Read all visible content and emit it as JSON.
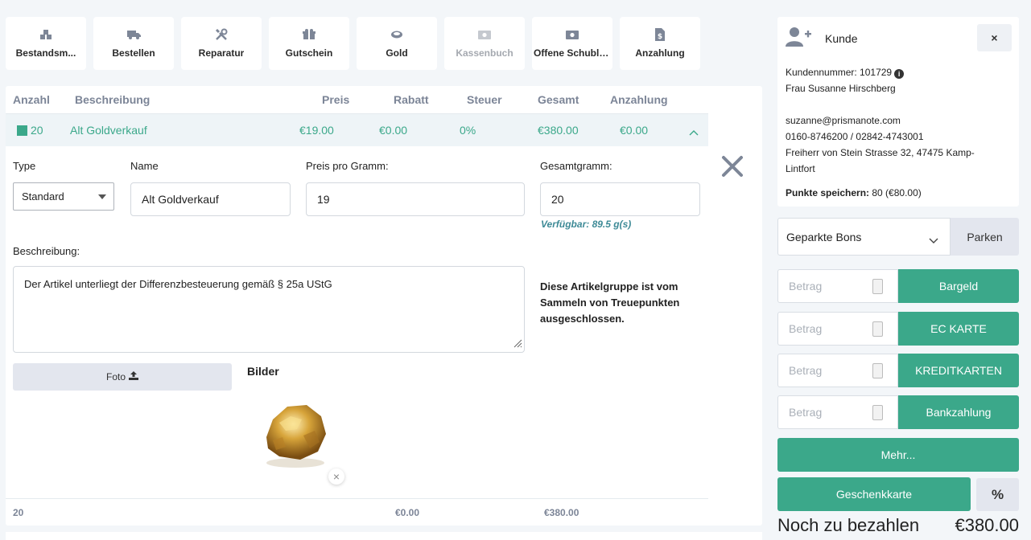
{
  "toolbar": [
    {
      "label": "Bestandsm...",
      "icon": "boxes-icon",
      "disabled": false
    },
    {
      "label": "Bestellen",
      "icon": "truck-icon",
      "disabled": false
    },
    {
      "label": "Reparatur",
      "icon": "tools-icon",
      "disabled": false
    },
    {
      "label": "Gutschein",
      "icon": "gift-icon",
      "disabled": false
    },
    {
      "label": "Gold",
      "icon": "gold-ring-icon",
      "disabled": false
    },
    {
      "label": "Kassenbuch",
      "icon": "money-bill-icon",
      "disabled": true
    },
    {
      "label": "Offene Schublade",
      "icon": "cash-drawer-icon",
      "disabled": false
    },
    {
      "label": "Anzahlung",
      "icon": "invoice-dollar-icon",
      "disabled": false
    }
  ],
  "table": {
    "headers": {
      "anzahl": "Anzahl",
      "beschreibung": "Beschreibung",
      "preis": "Preis",
      "rabatt": "Rabatt",
      "steuer": "Steuer",
      "gesamt": "Gesamt",
      "anzahlung": "Anzahlung"
    },
    "row": {
      "anzahl": "20",
      "beschreibung": "Alt Goldverkauf",
      "preis": "€19.00",
      "rabatt": "€0.00",
      "steuer": "0%",
      "gesamt": "€380.00",
      "anzahlung": "€0.00"
    },
    "footer": {
      "anzahl": "20",
      "rabatt": "€0.00",
      "gesamt": "€380.00"
    }
  },
  "detail": {
    "type_label": "Type",
    "type_value": "Standard",
    "name_label": "Name",
    "name_value": "Alt Goldverkauf",
    "price_label": "Preis pro Gramm:",
    "price_value": "19",
    "grams_label": "Gesamtgramm:",
    "grams_value": "20",
    "available": "Verfügbar: 89.5 g(s)",
    "desc_label": "Beschreibung:",
    "desc_value": "Der Artikel unterliegt der Differenzbesteuerung gemäß § 25a UStG",
    "note": "Diese Artikelgruppe ist vom Sammeln von Treuepunkten ausgeschlossen.",
    "photo_button": "Foto",
    "images_label": "Bilder",
    "image_remove": "×"
  },
  "customer": {
    "title": "Kunde",
    "close": "×",
    "number_line": "Kundennummer: 101729",
    "name": "Frau Susanne Hirschberg",
    "email": "suzanne@prismanote.com",
    "phones": "0160-8746200 / 02842-4743001",
    "address_1": "Freiherr von Stein Strasse 32, 47475 Kamp-",
    "address_2": "Lintfort",
    "points_label": "Punkte speichern:",
    "points_value": " 80 (€80.00)"
  },
  "parked": {
    "select": "Geparkte Bons",
    "button": "Parken"
  },
  "payments": [
    {
      "placeholder": "Betrag",
      "label": "Bargeld"
    },
    {
      "placeholder": "Betrag",
      "label": "EC KARTE"
    },
    {
      "placeholder": "Betrag",
      "label": "KREDITKARTEN"
    },
    {
      "placeholder": "Betrag",
      "label": "Bankzahlung"
    }
  ],
  "more_button": "Mehr...",
  "giftcard_button": "Geschenkkarte",
  "percent_button": "%",
  "due": {
    "label": "Noch zu bezahlen",
    "value": "€380.00"
  },
  "colors": {
    "accent": "#3ba88a",
    "available_text": "#3d8a96",
    "muted": "#7c8597"
  }
}
